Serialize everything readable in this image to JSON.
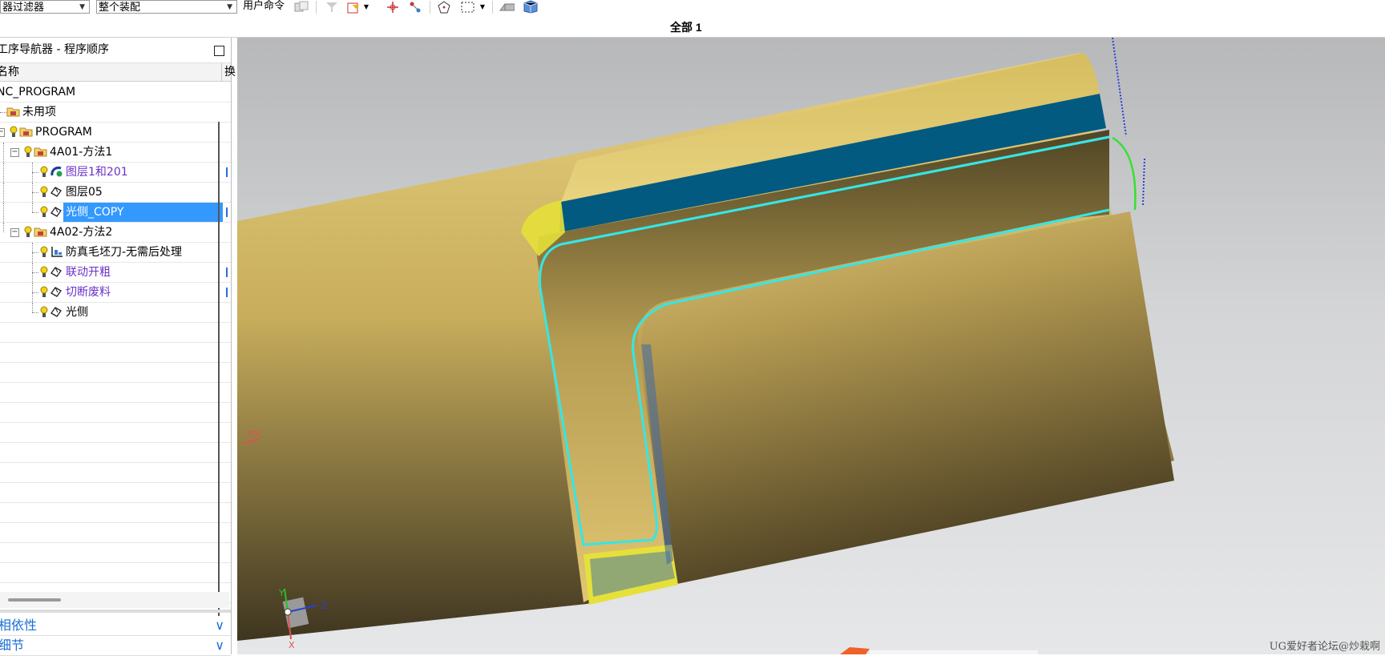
{
  "toolbar": {
    "filter_label": "器过滤器",
    "assembly_label": "整个装配",
    "user_command": "用户命令",
    "icons": [
      "filter-icon",
      "select-icon",
      "point-icon",
      "snap-icon",
      "polygon-icon",
      "rect-select-icon",
      "view-icon",
      "cube-icon"
    ]
  },
  "view": {
    "title": "全部 1"
  },
  "navigator": {
    "title": "工序导航器 - 程序顺序",
    "column_name": "名称",
    "column_2": "换",
    "items": [
      {
        "label": "NC_PROGRAM"
      },
      {
        "label": "未用项"
      },
      {
        "label": "PROGRAM"
      },
      {
        "label": "4A01-方法1"
      },
      {
        "label": "图层1和201"
      },
      {
        "label": "图层05"
      },
      {
        "label": "光侧_COPY"
      },
      {
        "label": "4A02-方法2"
      },
      {
        "label": "防真毛坯刀-无需后处理"
      },
      {
        "label": "联动开粗"
      },
      {
        "label": "切断废料"
      },
      {
        "label": "光侧"
      }
    ],
    "selected_item": "光侧_COPY"
  },
  "panels": {
    "dependencies": "相依性",
    "details": "细节"
  },
  "viewport": {
    "wcs_label": "XM",
    "axis_x": "X",
    "axis_y": "Y",
    "axis_z": "Z",
    "model_color": "#d9c068",
    "pocket_color": "#035a80",
    "toolpath_color": "#35e6e6"
  },
  "watermark": "UG爱好者论坛@炒栽啊"
}
